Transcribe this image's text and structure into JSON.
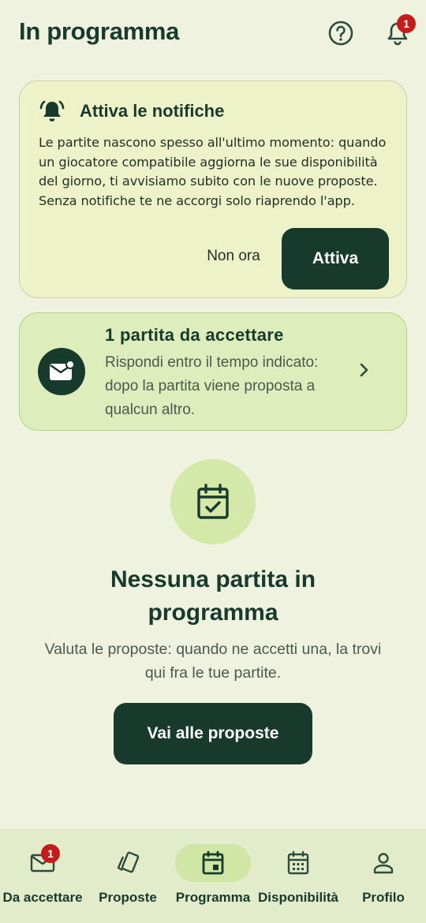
{
  "header": {
    "title": "In programma",
    "notification_count": "1"
  },
  "notification_card": {
    "title": "Attiva le notifiche",
    "body": "Le partite nascono spesso all'ultimo momento: quando un giocatore compatibile aggiorna le sue disponibilità del giorno, ti avvisiamo subito con le nuove proposte. Senza notifiche te ne accorgi solo riaprendo l'app.",
    "dismiss_label": "Non ora",
    "activate_label": "Attiva"
  },
  "pending_card": {
    "title": "1 partita da accettare",
    "description": "Rispondi entro il tempo indicato: dopo la partita viene proposta a qualcun altro."
  },
  "empty_state": {
    "title": "Nessuna partita in programma",
    "description": "Valuta le proposte: quando ne accetti una, la trovi qui fra le tue partite.",
    "cta_label": "Vai alle proposte"
  },
  "bottom_nav": {
    "items": [
      {
        "label": "Da accettare",
        "icon": "mail-icon",
        "badge": "1"
      },
      {
        "label": "Proposte",
        "icon": "cards-icon"
      },
      {
        "label": "Programma",
        "icon": "calendar-event-icon",
        "active": true
      },
      {
        "label": "Disponibilità",
        "icon": "calendar-grid-icon"
      },
      {
        "label": "Profilo",
        "icon": "person-icon"
      }
    ]
  },
  "colors": {
    "background": "#eef2df",
    "primary": "#173a2d",
    "badge": "#c41c1c",
    "notif_card_bg": "#eef2c8",
    "pending_card_bg": "#deedbc",
    "nav_bg": "#e2ecca",
    "nav_active_pill": "#cfe6a4"
  }
}
